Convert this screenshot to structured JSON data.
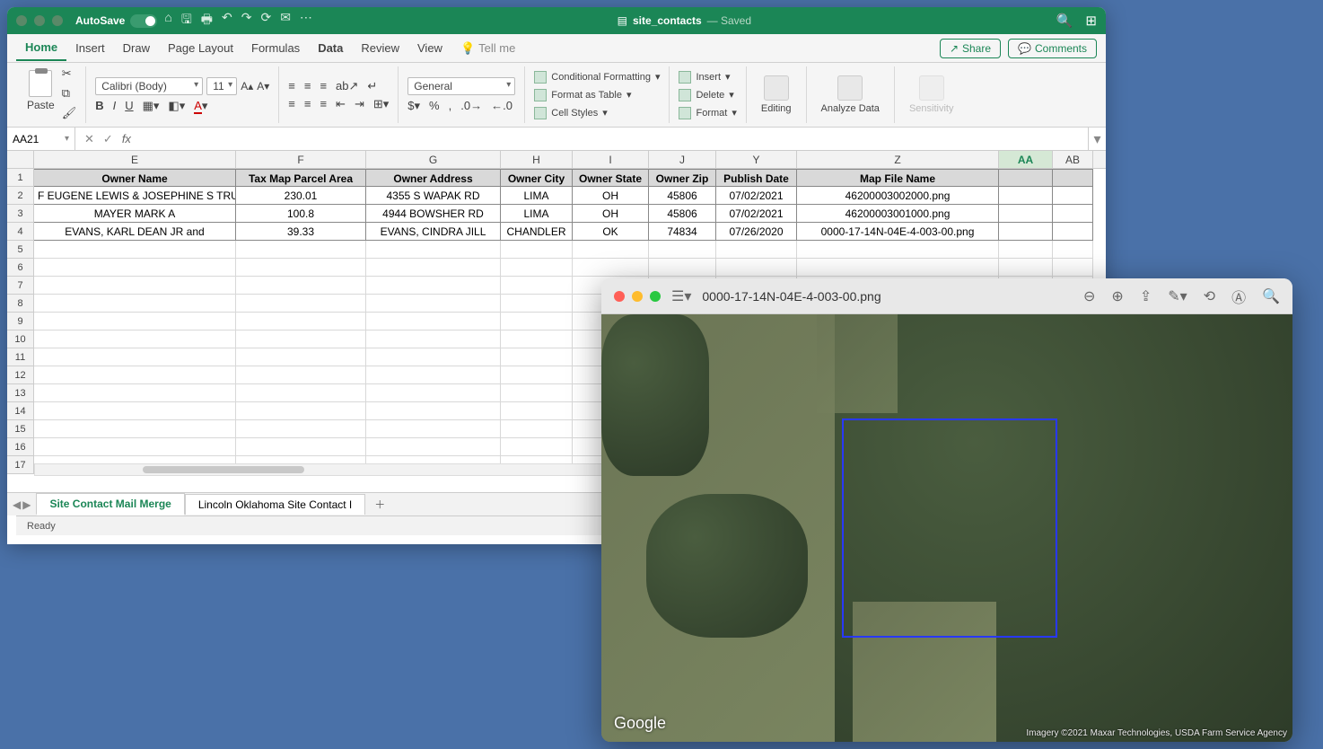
{
  "excel": {
    "titlebar": {
      "autosave": "AutoSave",
      "filename": "site_contacts",
      "status": "— Saved"
    },
    "tabs": {
      "home": "Home",
      "insert": "Insert",
      "draw": "Draw",
      "page_layout": "Page Layout",
      "formulas": "Formulas",
      "data": "Data",
      "review": "Review",
      "view": "View",
      "tellme": "Tell me"
    },
    "share": "Share",
    "comments": "Comments",
    "ribbon": {
      "paste": "Paste",
      "font_name": "Calibri (Body)",
      "font_size": "11",
      "number_format": "General",
      "cond_fmt": "Conditional Formatting",
      "fmt_table": "Format as Table",
      "cell_styles": "Cell Styles",
      "insert": "Insert",
      "delete": "Delete",
      "format": "Format",
      "editing": "Editing",
      "analyze": "Analyze Data",
      "sensitivity": "Sensitivity"
    },
    "name_box": "AA21",
    "columns": [
      "E",
      "F",
      "G",
      "H",
      "I",
      "J",
      "Y",
      "Z",
      "AA",
      "AB"
    ],
    "col_widths": [
      "c-E",
      "c-F",
      "c-G",
      "c-H",
      "c-I",
      "c-J",
      "c-Y",
      "c-Z",
      "c-AA",
      "c-AB"
    ],
    "headers": {
      "E": "Owner Name",
      "F": "Tax Map Parcel Area",
      "G": "Owner Address",
      "H": "Owner City",
      "I": "Owner State",
      "J": "Owner Zip",
      "Y": "Publish Date",
      "Z": "Map File Name",
      "AA": "",
      "AB": ""
    },
    "rows": [
      {
        "E": "F EUGENE LEWIS & JOSEPHINE S TRUST",
        "F": "230.01",
        "G": "4355 S WAPAK RD",
        "H": "LIMA",
        "I": "OH",
        "J": "45806",
        "Y": "07/02/2021",
        "Z": "46200003002000.png",
        "AA": "",
        "AB": ""
      },
      {
        "E": "MAYER MARK A",
        "F": "100.8",
        "G": "4944 BOWSHER RD",
        "H": "LIMA",
        "I": "OH",
        "J": "45806",
        "Y": "07/02/2021",
        "Z": "46200003001000.png",
        "AA": "",
        "AB": ""
      },
      {
        "E": "EVANS, KARL DEAN JR and",
        "F": "39.33",
        "G": "EVANS, CINDRA JILL",
        "H": "CHANDLER",
        "I": "OK",
        "J": "74834",
        "Y": "07/26/2020",
        "Z": "0000-17-14N-04E-4-003-00.png",
        "AA": "",
        "AB": ""
      }
    ],
    "sheets": {
      "tab1": "Site Contact Mail Merge",
      "tab2": "Lincoln Oklahoma Site Contact I"
    },
    "status": "Ready"
  },
  "preview": {
    "filename": "0000-17-14N-04E-4-003-00.png",
    "google": "Google",
    "attribution": "Imagery ©2021 Maxar Technologies, USDA Farm Service Agency"
  }
}
